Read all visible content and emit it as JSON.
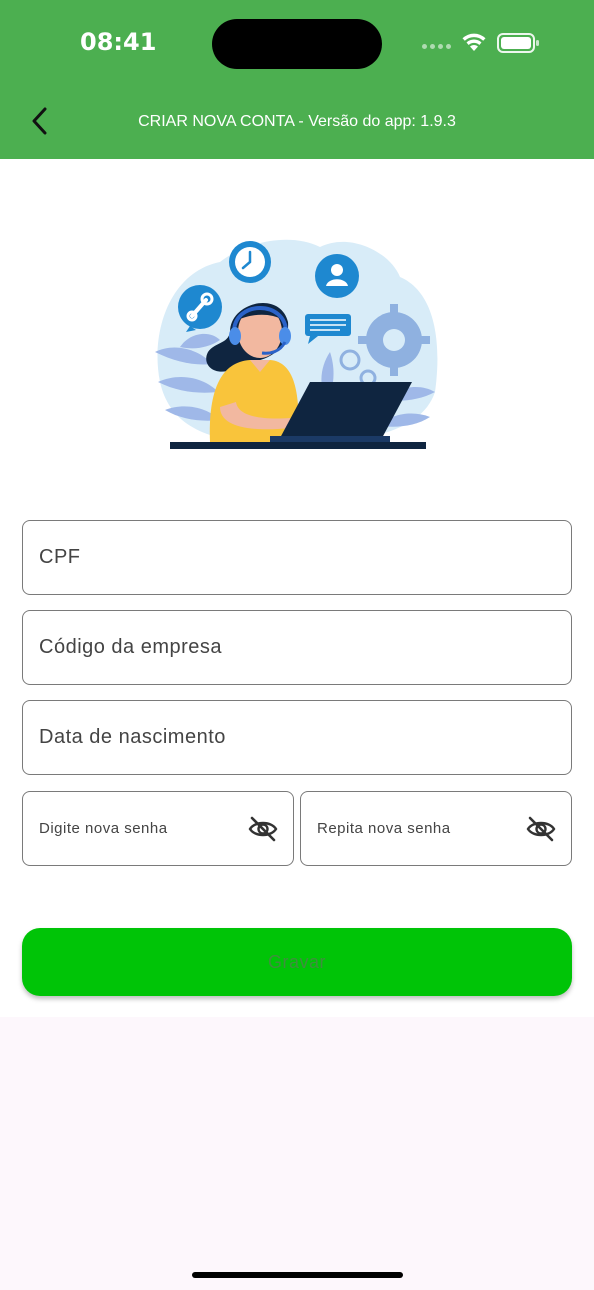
{
  "status_bar": {
    "time": "08:41"
  },
  "header": {
    "title": "CRIAR NOVA CONTA - Versão do app: 1.9.3",
    "background": "#4caf50",
    "back_icon": "chevron-left-icon"
  },
  "form": {
    "cpf_placeholder": "CPF",
    "company_code_placeholder": "Código da empresa",
    "birth_date_placeholder": "Data de nascimento",
    "new_password_placeholder": "Digite nova senha",
    "repeat_password_placeholder": "Repita nova senha",
    "password_visibility_icon": "eye-off-icon"
  },
  "actions": {
    "save_label": "Gravar",
    "save_color": "#00c407"
  }
}
